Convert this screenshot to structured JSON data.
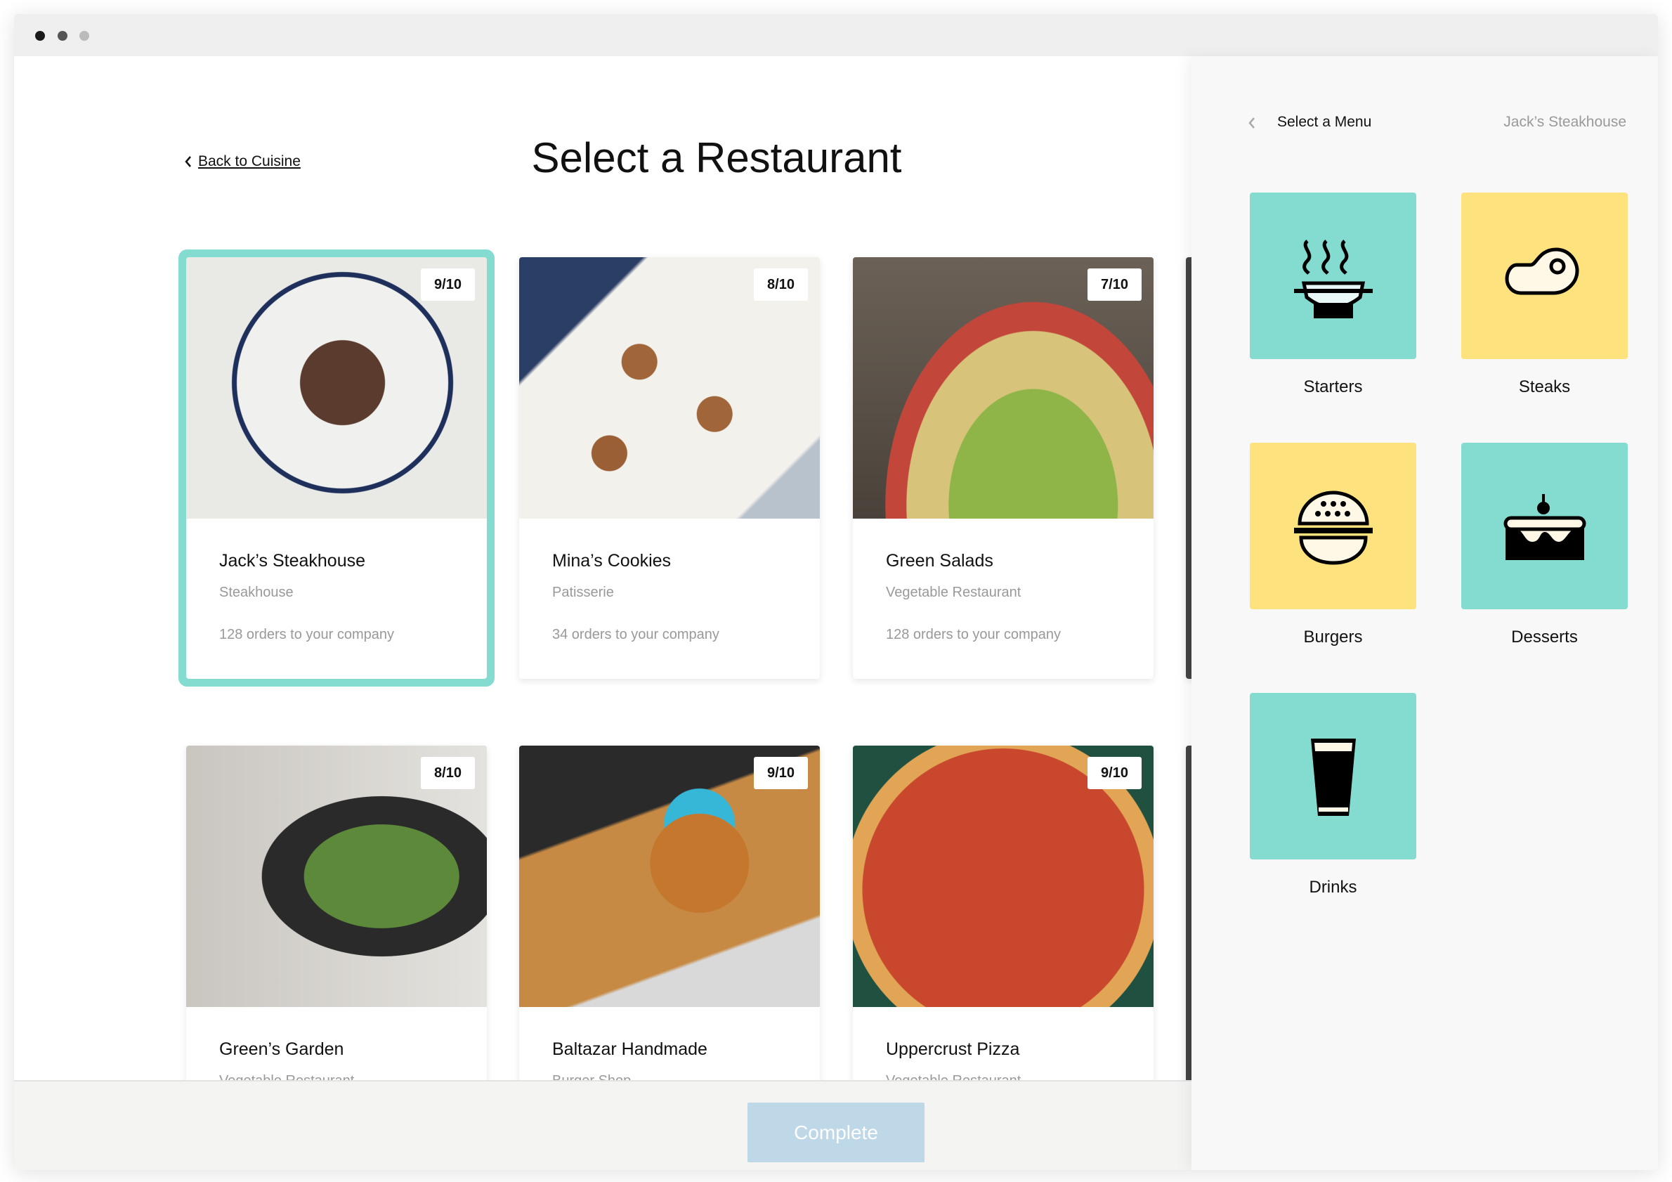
{
  "window": {
    "dots": [
      "#1a1a1a",
      "#555555",
      "#bbbbbb"
    ]
  },
  "main": {
    "back_label": "Back to Cuisine",
    "title": "Select a Restaurant",
    "restaurants": [
      {
        "name": "Jack’s Steakhouse",
        "type": "Steakhouse",
        "orders": "128 orders to your company",
        "rating": "9/10",
        "selected": true
      },
      {
        "name": "Mina’s Cookies",
        "type": "Patisserie",
        "orders": "34 orders to your company",
        "rating": "8/10"
      },
      {
        "name": "Green Salads",
        "type": "Vegetable Restaurant",
        "orders": "128 orders to your company",
        "rating": "7/10"
      },
      {
        "name": "Green’s Garden",
        "type": "Vegetable Restaurant",
        "rating": "8/10"
      },
      {
        "name": "Baltazar Handmade",
        "type": "Burger Shop",
        "rating": "9/10"
      },
      {
        "name": "Uppercrust Pizza",
        "type": "Vegetable Restaurant",
        "rating": "9/10"
      }
    ],
    "complete_label": "Complete"
  },
  "panel": {
    "title": "Select a Menu",
    "restaurant": "Jack’s Steakhouse",
    "menus": [
      {
        "label": "Starters",
        "icon": "soup-bowl-icon",
        "color": "#84dbd0"
      },
      {
        "label": "Steaks",
        "icon": "steak-icon",
        "color": "#fee27e"
      },
      {
        "label": "Burgers",
        "icon": "burger-icon",
        "color": "#fee27e"
      },
      {
        "label": "Desserts",
        "icon": "cake-icon",
        "color": "#84dbd0"
      },
      {
        "label": "Drinks",
        "icon": "drink-icon",
        "color": "#84dbd0"
      }
    ]
  },
  "colors": {
    "selected_border": "#84dbd0",
    "complete_button": "#bed8e8"
  }
}
